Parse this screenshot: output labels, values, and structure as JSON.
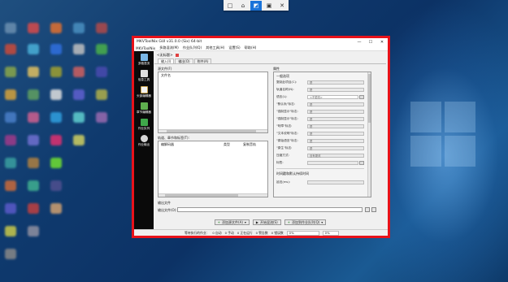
{
  "snap_bar": {
    "items": [
      "□",
      "⌂",
      "◩",
      "▣",
      "✕"
    ]
  },
  "window": {
    "title": "MKVToolNix GUI v31.0.0 (Six) 64-bit",
    "controls": {
      "minimize": "—",
      "maximize": "☐",
      "close": "✕"
    },
    "menu": [
      "MKVToolNix",
      "多路混流(M)",
      "作业队列(Q)",
      "其他工具(H)",
      "设置(S)",
      "帮助(H)"
    ]
  },
  "sidebar": {
    "items": [
      {
        "label": "多路混流",
        "icon": "mux-icon"
      },
      {
        "label": "信息工具",
        "icon": "info-icon"
      },
      {
        "label": "头部编辑器",
        "icon": "header-editor-icon"
      },
      {
        "label": "章节编辑器",
        "icon": "chapter-icon"
      },
      {
        "label": "作业队列",
        "icon": "queue-icon"
      },
      {
        "label": "作业输出",
        "icon": "job-output-icon"
      }
    ]
  },
  "file_tab": {
    "label": "<无标题>"
  },
  "tabs": [
    "输入(I)",
    "输出(O)",
    "附件(A)"
  ],
  "input": {
    "source_files_group": "源文件(F)",
    "file_name_header": "文件名",
    "tracks_group": "轨道、章节和标签(T):",
    "tracks_headers": [
      "编解码器",
      "类型",
      "复制音轨"
    ]
  },
  "properties": {
    "group": "属性",
    "general_options": "一般选项",
    "items": [
      {
        "label": "复制此项目(C):",
        "value": "是"
      },
      {
        "label": "轨道名称(N):",
        "value": "是"
      },
      {
        "label": "语言(L):",
        "value": "<不更改>"
      },
      {
        "label": "\"默认轨\"标志:",
        "value": "是"
      },
      {
        "label": "\"强制显示\"标志:",
        "value": "是"
      },
      {
        "label": "\"强制显示\"标志:",
        "value": "是"
      },
      {
        "label": "\"听障\"标志:",
        "value": "是"
      },
      {
        "label": "\"文本说明\"标志:",
        "value": "是"
      },
      {
        "label": "\"原始语言\"标志:",
        "value": "是"
      },
      {
        "label": "\"原生\"标志:",
        "value": "是"
      },
      {
        "label": "压缩方式:",
        "value": "没有更改"
      },
      {
        "label": "标签:",
        "value": ""
      }
    ],
    "timestamps_group": "时间戳和默认持续时间",
    "delay_label": "延迟(ms):"
  },
  "output": {
    "group": "输出文件",
    "file_label": "输出文件(O):"
  },
  "actions": {
    "add_source": "添加源文件(A)",
    "start_mux": "开始混流(S)",
    "add_to_queue": "添加到作业队列(Q)"
  },
  "status": {
    "pending_jobs": "等待执行的作业：",
    "auto": "0 自动",
    "manual": "0 手动",
    "running": "0 正在运行",
    "warnings": "0 警告数",
    "errors": "0 错误数",
    "progress": "0%",
    "progress2": "0%"
  }
}
